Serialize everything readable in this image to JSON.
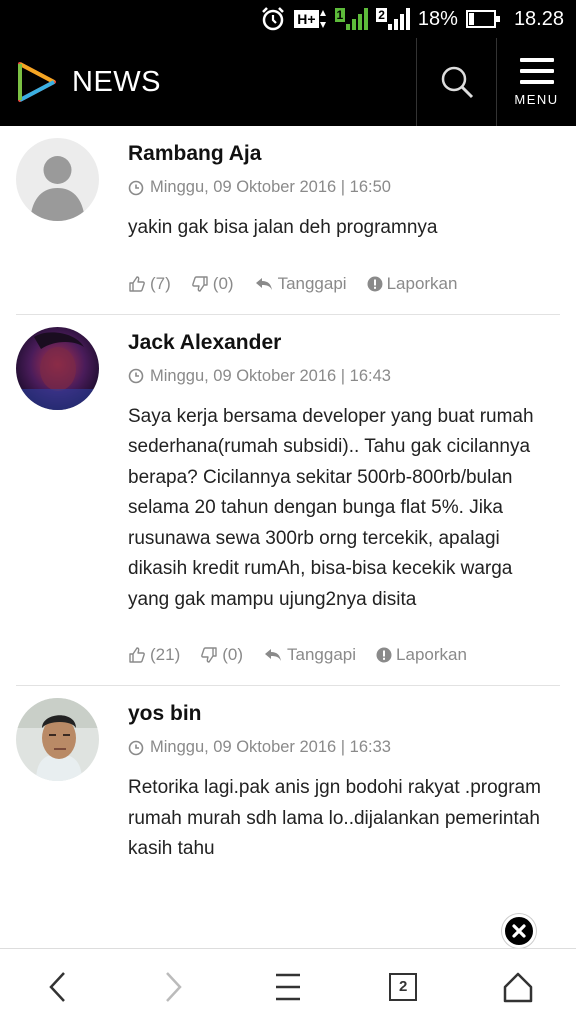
{
  "status_bar": {
    "battery": "18%",
    "time": "18.28",
    "network": "H+",
    "sim1": "1",
    "sim2": "2",
    "battery_level": 0.18,
    "icons": [
      "alarm-icon",
      "network-type-icon",
      "signal-sim1-icon",
      "signal-sim2-icon",
      "battery-icon"
    ]
  },
  "app_bar": {
    "title": "NEWS",
    "menu_label": "MENU",
    "icons": [
      "logo-icon",
      "search-icon",
      "menu-icon"
    ]
  },
  "comments": [
    {
      "author": "Rambang Aja",
      "date": "Minggu, 09 Oktober 2016 | 16:50",
      "text": "yakin gak bisa jalan deh programnya",
      "likes": "(7)",
      "dislikes": "(0)",
      "reply": "Tanggapi",
      "report": "Laporkan",
      "avatar": "placeholder-silhouette"
    },
    {
      "author": "Jack Alexander",
      "date": "Minggu, 09 Oktober 2016 | 16:43",
      "text": "Saya kerja bersama developer yang buat rumah sederhana(rumah subsidi).. Tahu gak cicilannya berapa? Cicilannya sekitar 500rb-800rb/bulan selama 20 tahun dengan bunga flat 5%. Jika rusunawa sewa 300rb orng tercekik, apalagi dikasih kredit rumAh, bisa-bisa kecekik warga yang gak mampu ujung2nya disita",
      "likes": "(21)",
      "dislikes": "(0)",
      "reply": "Tanggapi",
      "report": "Laporkan",
      "avatar": "photo-purple"
    },
    {
      "author": "yos bin",
      "date": "Minggu, 09 Oktober 2016 | 16:33",
      "text": "Retorika lagi.pak anis jgn bodohi rakyat .program rumah murah sdh lama lo..dijalankan pemerintah kasih tahu",
      "likes": "",
      "dislikes": "",
      "reply": "",
      "report": "",
      "avatar": "photo-man"
    }
  ],
  "bottom_nav": {
    "tab_count": "2",
    "icons": [
      "back-icon",
      "forward-icon",
      "menu-list-icon",
      "tabs-icon",
      "home-icon"
    ]
  },
  "colors": {
    "appbar_bg": "#000000",
    "text_muted": "#8a8a8a",
    "signal_green": "#5dbb3a"
  }
}
